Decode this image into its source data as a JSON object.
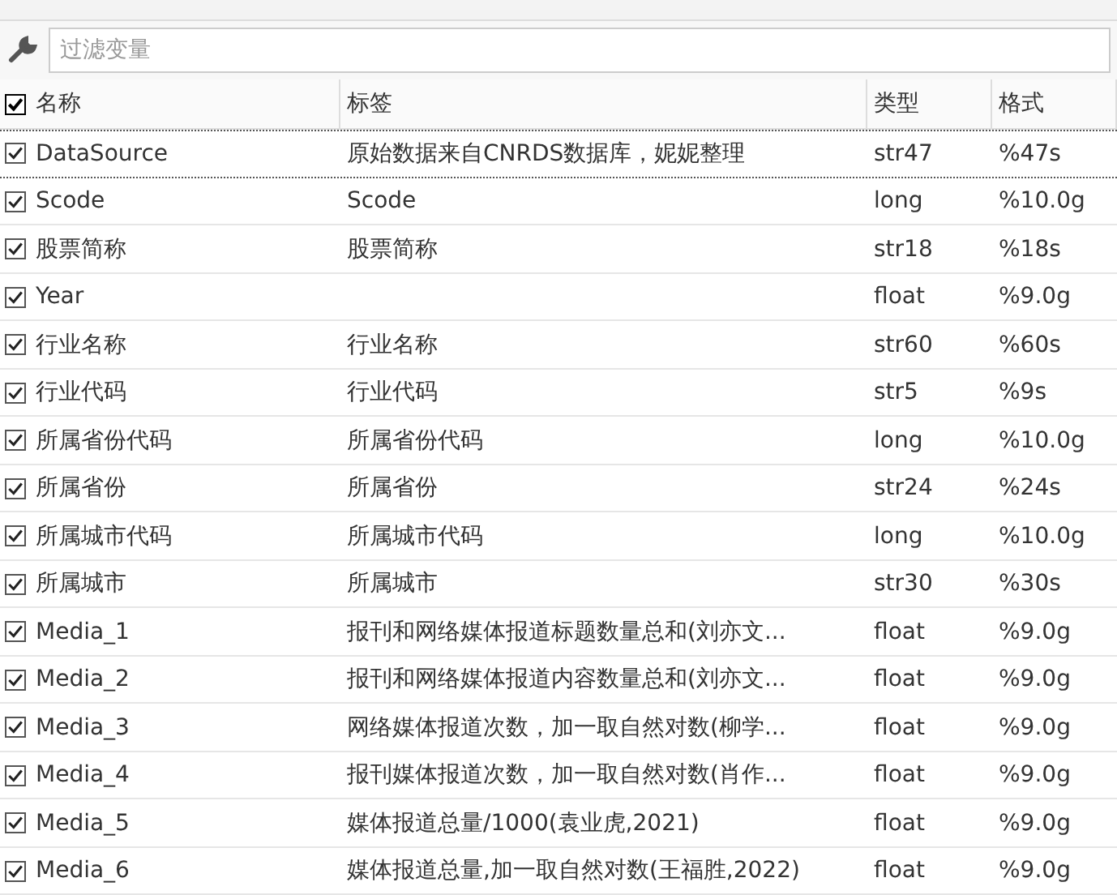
{
  "filter": {
    "placeholder": "过滤变量"
  },
  "columns": [
    {
      "label": "名称",
      "checked": true
    },
    {
      "label": "标签"
    },
    {
      "label": "类型"
    },
    {
      "label": "格式"
    }
  ],
  "rows": [
    {
      "name": "DataSource",
      "label": "原始数据来自CNRDS数据库，妮妮整理",
      "type": "str47",
      "format": "%47s",
      "checked": true,
      "focused": true
    },
    {
      "name": "Scode",
      "label": "Scode",
      "type": "long",
      "format": "%10.0g",
      "checked": true,
      "focused": false
    },
    {
      "name": "股票简称",
      "label": "股票简称",
      "type": "str18",
      "format": "%18s",
      "checked": true,
      "focused": false
    },
    {
      "name": "Year",
      "type": "float",
      "format": "%9.0g",
      "checked": true,
      "focused": false
    },
    {
      "name": "行业名称",
      "label": "行业名称",
      "type": "str60",
      "format": "%60s",
      "checked": true,
      "focused": false
    },
    {
      "name": "行业代码",
      "label": "行业代码",
      "type": "str5",
      "format": "%9s",
      "checked": true,
      "focused": false
    },
    {
      "name": "所属省份代码",
      "label": "所属省份代码",
      "type": "long",
      "format": "%10.0g",
      "checked": true,
      "focused": false
    },
    {
      "name": "所属省份",
      "label": "所属省份",
      "type": "str24",
      "format": "%24s",
      "checked": true,
      "focused": false
    },
    {
      "name": "所属城市代码",
      "label": "所属城市代码",
      "type": "long",
      "format": "%10.0g",
      "checked": true,
      "focused": false
    },
    {
      "name": "所属城市",
      "label": "所属城市",
      "type": "str30",
      "format": "%30s",
      "checked": true,
      "focused": false
    },
    {
      "name": "Media_1",
      "label": "报刊和网络媒体报道标题数量总和(刘亦文...",
      "type": "float",
      "format": "%9.0g",
      "checked": true,
      "focused": false
    },
    {
      "name": "Media_2",
      "label": "报刊和网络媒体报道内容数量总和(刘亦文...",
      "type": "float",
      "format": "%9.0g",
      "checked": true,
      "focused": false
    },
    {
      "name": "Media_3",
      "label": "网络媒体报道次数，加一取自然对数(柳学...",
      "type": "float",
      "format": "%9.0g",
      "checked": true,
      "focused": false
    },
    {
      "name": "Media_4",
      "label": "报刊媒体报道次数，加一取自然对数(肖作...",
      "type": "float",
      "format": "%9.0g",
      "checked": true,
      "focused": false
    },
    {
      "name": "Media_5",
      "label": "媒体报道总量/1000(袁业虎,2021)",
      "type": "float",
      "format": "%9.0g",
      "checked": true,
      "focused": false
    },
    {
      "name": "Media_6",
      "label": "媒体报道总量,加一取自然对数(王福胜,2022)",
      "type": "float",
      "format": "%9.0g",
      "checked": true,
      "focused": false
    }
  ]
}
